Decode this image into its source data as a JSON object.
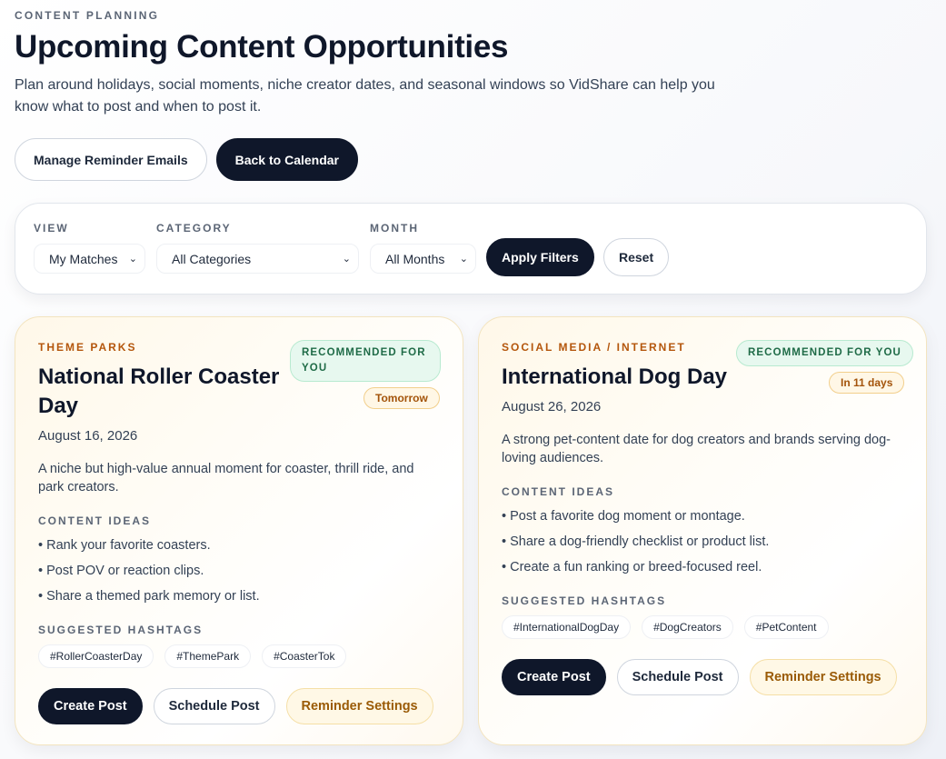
{
  "header": {
    "eyebrow": "CONTENT PLANNING",
    "title": "Upcoming Content Opportunities",
    "subtitle": "Plan around holidays, social moments, niche creator dates, and seasonal windows so VidShare can help you know what to post and when to post it."
  },
  "actions": {
    "manage_label": "Manage Reminder Emails",
    "back_label": "Back to Calendar"
  },
  "filters": {
    "view_label": "VIEW",
    "view_value": "My Matches",
    "category_label": "CATEGORY",
    "category_value": "All Categories",
    "month_label": "MONTH",
    "month_value": "All Months",
    "apply_label": "Apply Filters",
    "reset_label": "Reset"
  },
  "cards": [
    {
      "category": "THEME PARKS",
      "title": "National Roller Coaster Day",
      "date": "August 16, 2026",
      "recommended": "RECOMMENDED FOR YOU",
      "when": "Tomorrow",
      "description": "A niche but high-value annual moment for coaster, thrill ride, and park creators.",
      "ideas_label": "CONTENT IDEAS",
      "ideas": [
        "• Rank your favorite coasters.",
        "• Post POV or reaction clips.",
        "• Share a themed park memory or list."
      ],
      "hashtags_label": "SUGGESTED HASHTAGS",
      "hashtags": [
        "#RollerCoasterDay",
        "#ThemePark",
        "#CoasterTok"
      ],
      "create_label": "Create Post",
      "schedule_label": "Schedule Post",
      "reminder_label": "Reminder Settings"
    },
    {
      "category": "SOCIAL MEDIA / INTERNET",
      "title": "International Dog Day",
      "date": "August 26, 2026",
      "recommended": "RECOMMENDED FOR YOU",
      "when": "In 11 days",
      "description": "A strong pet-content date for dog creators and brands serving dog-loving audiences.",
      "ideas_label": "CONTENT IDEAS",
      "ideas": [
        "• Post a favorite dog moment or montage.",
        "• Share a dog-friendly checklist or product list.",
        "• Create a fun ranking or breed-focused reel."
      ],
      "hashtags_label": "SUGGESTED HASHTAGS",
      "hashtags": [
        "#InternationalDogDay",
        "#DogCreators",
        "#PetContent"
      ],
      "create_label": "Create Post",
      "schedule_label": "Schedule Post",
      "reminder_label": "Reminder Settings"
    }
  ],
  "icons": {
    "select_chevron": "chevron-down-icon"
  },
  "colors": {
    "dark": "#0f172a",
    "category": "#b4560c",
    "recommended_bg": "#e7f8ef",
    "when_text": "#a3530a"
  }
}
